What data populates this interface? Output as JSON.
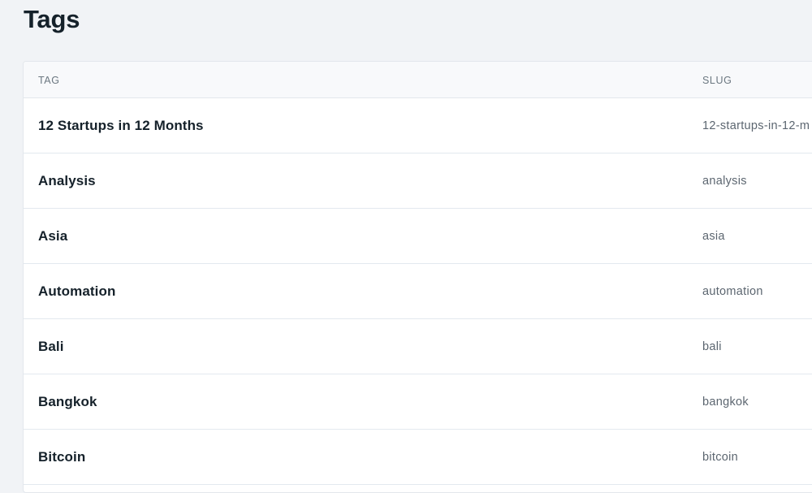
{
  "page": {
    "title": "Tags"
  },
  "table": {
    "columns": {
      "tag": "TAG",
      "slug": "SLUG"
    },
    "rows": [
      {
        "name": "12 Startups in 12 Months",
        "slug": "12-startups-in-12-m"
      },
      {
        "name": "Analysis",
        "slug": "analysis"
      },
      {
        "name": "Asia",
        "slug": "asia"
      },
      {
        "name": "Automation",
        "slug": "automation"
      },
      {
        "name": "Bali",
        "slug": "bali"
      },
      {
        "name": "Bangkok",
        "slug": "bangkok"
      },
      {
        "name": "Bitcoin",
        "slug": "bitcoin"
      }
    ]
  }
}
